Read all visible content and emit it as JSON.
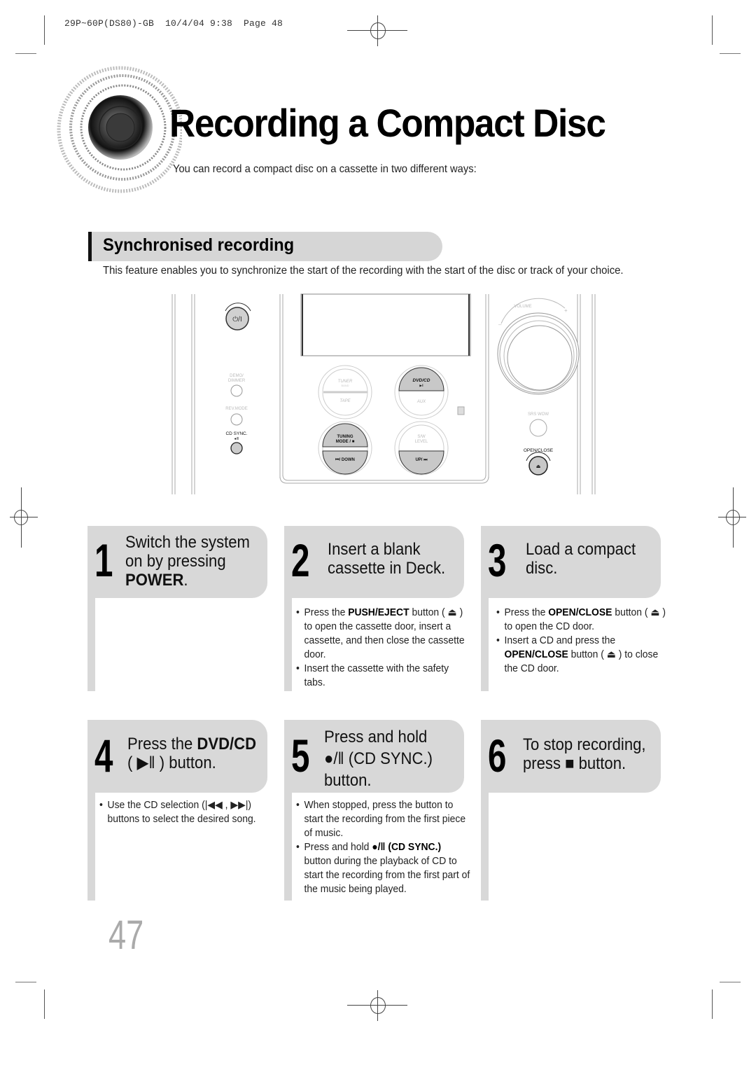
{
  "print_header": "29P~60P(DS80)-GB  10/4/04 9:38  Page 48",
  "title": "Recording a Compact Disc",
  "subtitle": "You can record a compact disc on a cassette in two different ways:",
  "section": {
    "title": "Synchronised recording",
    "description": "This feature enables you to synchronize the start of the recording with the start of the disc or track of your choice."
  },
  "device_panel": {
    "power_label": "⏻/I",
    "demo_dimmer_label": "DEMO/ DIMMER",
    "rev_mode_label": "REV.MODE",
    "cd_sync_label": "CD SYNC.",
    "cd_sync_symbol": "●/‖",
    "tuner_band_label": "TUNER",
    "tuner_band_sub": "BAND",
    "tape_label": "TAPE",
    "dvd_cd_label": "DVD/CD",
    "dvd_cd_symbol": "▶‖",
    "aux_label": "AUX",
    "tuning_mode_label": "TUNING",
    "tuning_mode_label2": "MODE / ■",
    "down_label": "⏮/ DOWN",
    "sw_level_label": "S/W",
    "sw_level_label2": "LEVEL",
    "up_label": "UP/ ⏭",
    "volume_label": "VOLUME",
    "volume_minus": "–",
    "volume_plus": "+",
    "srs_wow_label": "SRS WOW",
    "open_close_label": "OPEN/CLOSE",
    "eject_symbol": "⏏"
  },
  "steps": [
    {
      "number": "1",
      "heading_lines": [
        "Switch the system",
        "on by pressing"
      ],
      "heading_bold": "POWER",
      "heading_suffix": ".",
      "bullets": []
    },
    {
      "number": "2",
      "heading_lines": [
        "Insert a blank",
        "cassette in Deck."
      ],
      "bullets": [
        {
          "pre": "Press the ",
          "bold": "PUSH/EJECT",
          "post": " button ( ⏏ ) to open the cassette door, insert a cassette, and then close the cassette door."
        },
        {
          "pre": "Insert the cassette with the safety tabs.",
          "bold": "",
          "post": ""
        }
      ]
    },
    {
      "number": "3",
      "heading_lines": [
        "Load a compact",
        "disc."
      ],
      "bullets": [
        {
          "pre": "Press the ",
          "bold": "OPEN/CLOSE",
          "post": " button ( ⏏ ) to open the CD door."
        },
        {
          "pre": "Insert a CD and press the ",
          "bold": "OPEN/CLOSE",
          "post": " button ( ⏏ ) to close the CD door."
        }
      ]
    },
    {
      "number": "4",
      "heading_pre": "Press the ",
      "heading_bold": "DVD/CD",
      "heading_line2": "( ▶‖ ) button.",
      "bullets": [
        {
          "pre": "Use the CD selection (|◀◀ , ▶▶|) buttons to select the desired song.",
          "bold": "",
          "post": ""
        }
      ]
    },
    {
      "number": "5",
      "heading_lines": [
        "Press and hold",
        "●/‖ (CD SYNC.)",
        "button."
      ],
      "bullets": [
        {
          "pre": "When stopped, press the button to start the recording from the first piece of music.",
          "bold": "",
          "post": ""
        },
        {
          "pre": "Press and hold ",
          "bold": "●/‖  (CD SYNC.)",
          "post": " button during the playback of CD to start the recording from the first part of the music being played."
        }
      ]
    },
    {
      "number": "6",
      "heading_lines": [
        "To stop recording,",
        "press ■ button."
      ],
      "bullets": []
    }
  ],
  "page_number": "47"
}
